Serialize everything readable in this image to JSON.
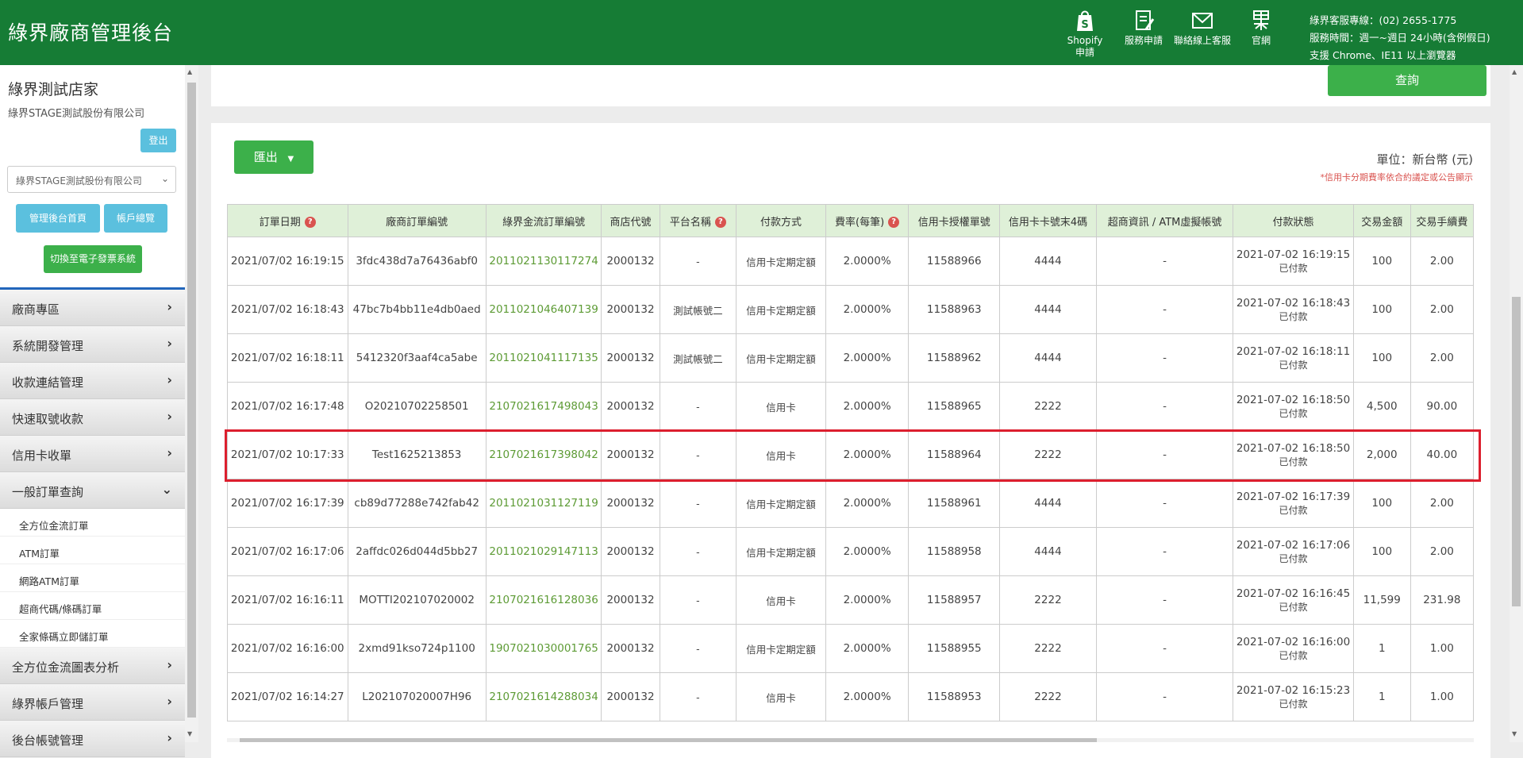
{
  "header": {
    "brand": "綠界廠商管理後台",
    "links": [
      {
        "label": "Shopify",
        "label2": "申請",
        "icon": "shopify-bag-icon"
      },
      {
        "label": "服務申請",
        "label2": "",
        "icon": "form-edit-icon"
      },
      {
        "label": "聯絡線上客服",
        "label2": "",
        "icon": "mail-icon"
      },
      {
        "label": "官網",
        "label2": "",
        "icon": "ecpay-logo-icon"
      }
    ],
    "info": [
      "綠界客服專線：(02) 2655-1775",
      "服務時間：週一~週日 24小時(含例假日)",
      "支援 Chrome、IE11 以上瀏覽器"
    ]
  },
  "sidebar": {
    "store_name": "綠界測試店家",
    "company": "綠界STAGE測試股份有限公司",
    "logout": "登出",
    "company_select": "綠界STAGE測試股份有限公司",
    "home_button": "管理後台首頁",
    "account_button": "帳戶總覽",
    "einvoice_button": "切換至電子發票系統",
    "menu_top": [
      "廠商專區",
      "系統開發管理",
      "收款連結管理",
      "快速取號收款",
      "信用卡收單",
      "一般訂單查詢"
    ],
    "submenu": [
      "全方位金流訂單",
      "ATM訂單",
      "網路ATM訂單",
      "超商代碼/條碼訂單",
      "全家條碼立即儲訂單"
    ],
    "menu_bottom": [
      "全方位金流圖表分析",
      "綠界帳戶管理",
      "後台帳號管理"
    ]
  },
  "main": {
    "query_button": "查詢",
    "export_button": "匯出",
    "unit": "單位：新台幣 (元)",
    "note": "*信用卡分期費率依合約議定或公告顯示"
  },
  "table": {
    "headers": [
      "訂單日期",
      "廠商訂單編號",
      "綠界金流訂單編號",
      "商店代號",
      "平台名稱",
      "付款方式",
      "費率(每筆)",
      "信用卡授權單號",
      "信用卡卡號末4碼",
      "超商資訊 / ATM虛擬帳號",
      "付款狀態",
      "交易金額",
      "交易手續費"
    ],
    "help_columns": [
      0,
      4,
      6
    ],
    "highlight_row": 4,
    "rows": [
      [
        "2021/07/02 16:19:15",
        "3fdc438d7a76436abf0",
        "2011021130117274",
        "2000132",
        "-",
        "信用卡定期定額",
        "2.0000%",
        "11588966",
        "4444",
        "-",
        "2021-07-02 16:19:15",
        "已付款",
        "100",
        "2.00"
      ],
      [
        "2021/07/02 16:18:43",
        "47bc7b4bb11e4db0aed",
        "2011021046407139",
        "2000132",
        "測試帳號二",
        "信用卡定期定額",
        "2.0000%",
        "11588963",
        "4444",
        "-",
        "2021-07-02 16:18:43",
        "已付款",
        "100",
        "2.00"
      ],
      [
        "2021/07/02 16:18:11",
        "5412320f3aaf4ca5abe",
        "2011021041117135",
        "2000132",
        "測試帳號二",
        "信用卡定期定額",
        "2.0000%",
        "11588962",
        "4444",
        "-",
        "2021-07-02 16:18:11",
        "已付款",
        "100",
        "2.00"
      ],
      [
        "2021/07/02 16:17:48",
        "O20210702258501",
        "2107021617498043",
        "2000132",
        "-",
        "信用卡",
        "2.0000%",
        "11588965",
        "2222",
        "-",
        "2021-07-02 16:18:50",
        "已付款",
        "4,500",
        "90.00"
      ],
      [
        "2021/07/02 10:17:33",
        "Test1625213853",
        "2107021617398042",
        "2000132",
        "-",
        "信用卡",
        "2.0000%",
        "11588964",
        "2222",
        "-",
        "2021-07-02 16:18:50",
        "已付款",
        "2,000",
        "40.00"
      ],
      [
        "2021/07/02 16:17:39",
        "cb89d77288e742fab42",
        "2011021031127119",
        "2000132",
        "-",
        "信用卡定期定額",
        "2.0000%",
        "11588961",
        "4444",
        "-",
        "2021-07-02 16:17:39",
        "已付款",
        "100",
        "2.00"
      ],
      [
        "2021/07/02 16:17:06",
        "2affdc026d044d5bb27",
        "2011021029147113",
        "2000132",
        "-",
        "信用卡定期定額",
        "2.0000%",
        "11588958",
        "4444",
        "-",
        "2021-07-02 16:17:06",
        "已付款",
        "100",
        "2.00"
      ],
      [
        "2021/07/02 16:16:11",
        "MOTTI202107020002",
        "2107021616128036",
        "2000132",
        "-",
        "信用卡",
        "2.0000%",
        "11588957",
        "2222",
        "-",
        "2021-07-02 16:16:45",
        "已付款",
        "11,599",
        "231.98"
      ],
      [
        "2021/07/02 16:16:00",
        "2xmd91kso724p1100",
        "1907021030001765",
        "2000132",
        "-",
        "信用卡定期定額",
        "2.0000%",
        "11588955",
        "2222",
        "-",
        "2021-07-02 16:16:00",
        "已付款",
        "1",
        "1.00"
      ],
      [
        "2021/07/02 16:14:27",
        "L202107020007H96",
        "2107021614288034",
        "2000132",
        "-",
        "信用卡",
        "2.0000%",
        "11588953",
        "2222",
        "-",
        "2021-07-02 16:15:23",
        "已付款",
        "1",
        "1.00"
      ]
    ]
  }
}
